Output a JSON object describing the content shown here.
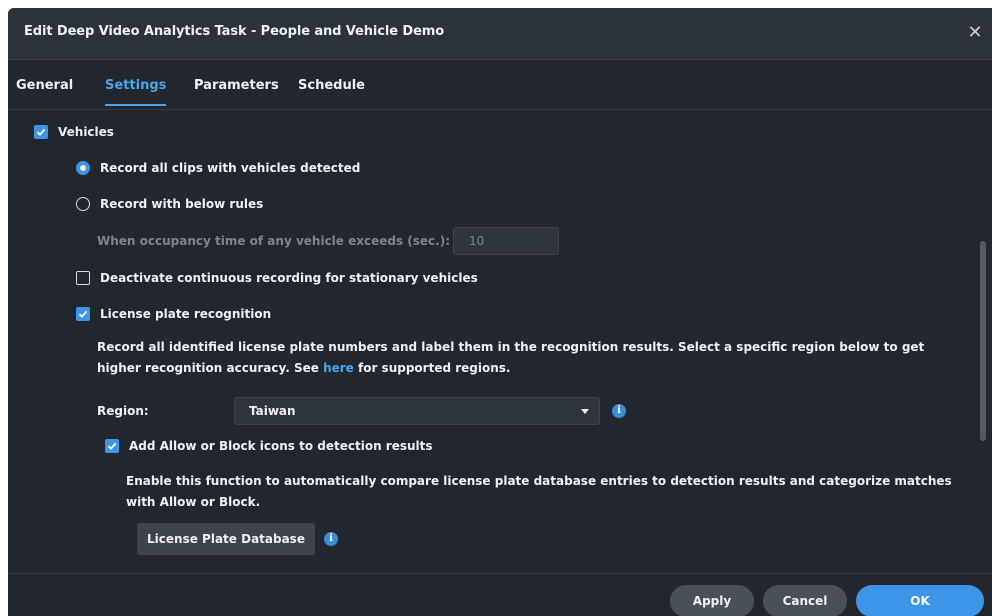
{
  "dialog": {
    "title": "Edit Deep Video Analytics Task - People and Vehicle Demo",
    "close_glyph": "✕"
  },
  "tabs": [
    {
      "label": "General",
      "active": false
    },
    {
      "label": "Settings",
      "active": true
    },
    {
      "label": "Parameters",
      "active": false
    },
    {
      "label": "Schedule",
      "active": false
    }
  ],
  "settings": {
    "vehicles": {
      "label": "Vehicles",
      "checked": true
    },
    "record_all": {
      "label": "Record all clips with vehicles detected",
      "selected": true
    },
    "record_rules": {
      "label": "Record with below rules",
      "selected": false
    },
    "occupancy": {
      "label": "When occupancy time of any vehicle exceeds (sec.):",
      "value": "10"
    },
    "deactivate_continuous": {
      "label": "Deactivate continuous recording for stationary vehicles",
      "checked": false
    },
    "lpr": {
      "label": "License plate recognition",
      "checked": true
    },
    "lpr_desc": {
      "part1": "Record all identified license plate numbers and label them in the recognition results. Select a specific region below to get higher recognition accuracy. See ",
      "link": "here",
      "part2": " for supported regions."
    },
    "region": {
      "label": "Region:",
      "value": "Taiwan"
    },
    "allow_block": {
      "label": "Add Allow or Block icons to detection results",
      "checked": true
    },
    "allow_block_desc": "Enable this function to automatically compare license plate database entries to detection results and categorize matches with Allow or Block.",
    "db_button": "License Plate Database",
    "info_glyph": "i"
  },
  "footer": {
    "apply": "Apply",
    "cancel": "Cancel",
    "ok": "OK"
  },
  "colors": {
    "accent": "#3d95e8",
    "background": "#22272e",
    "titlebar": "#2c323a"
  }
}
